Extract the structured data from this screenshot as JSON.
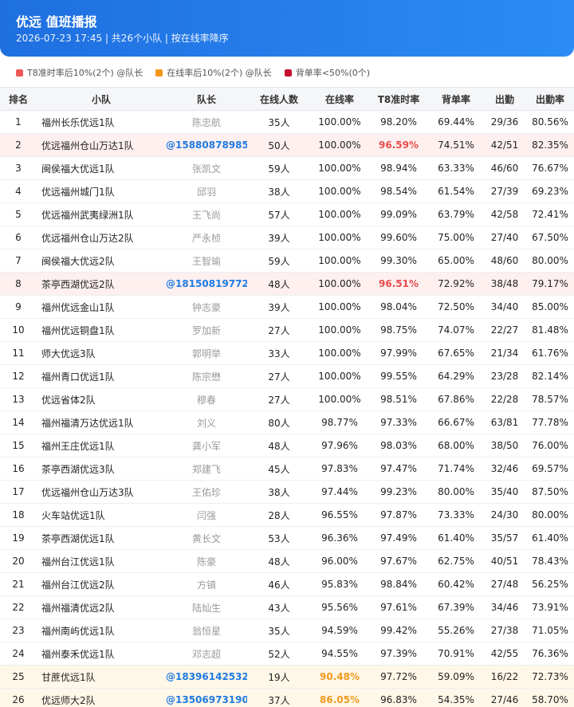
{
  "header": {
    "title": "优远 值班播报",
    "subtitle": "2026-07-23 17:45 | 共26个小队 | 按在线率降序"
  },
  "legend": [
    {
      "label": "T8准时率后10%(2个) @队长",
      "color": "#f0595a"
    },
    {
      "label": "在线率后10%(2个) @队长",
      "color": "#f3961c"
    },
    {
      "label": "背单率<50%(0个)",
      "color": "#c8102e"
    }
  ],
  "table": {
    "columns": [
      "排名",
      "小队",
      "队长",
      "在线人数",
      "在线率",
      "T8准时率",
      "背单率",
      "出勤",
      "出勤率"
    ],
    "rows": [
      {
        "rank": "1",
        "team": "福州长乐优远1队",
        "captain": "陈忠航",
        "online": "35人",
        "online_rate": "100.00%",
        "t8": "98.20%",
        "back": "69.44%",
        "attend": "29/36",
        "attend_rate": "80.56%"
      },
      {
        "rank": "2",
        "team": "优远福州仓山万达1队",
        "captain": "@15880878985",
        "online": "50人",
        "online_rate": "100.00%",
        "t8": "96.59%",
        "back": "74.51%",
        "attend": "42/51",
        "attend_rate": "82.35%",
        "flag": "t8"
      },
      {
        "rank": "3",
        "team": "闽侯福大优远1队",
        "captain": "张凯文",
        "online": "59人",
        "online_rate": "100.00%",
        "t8": "98.94%",
        "back": "63.33%",
        "attend": "46/60",
        "attend_rate": "76.67%"
      },
      {
        "rank": "4",
        "team": "优远福州城门1队",
        "captain": "邱羽",
        "online": "38人",
        "online_rate": "100.00%",
        "t8": "98.54%",
        "back": "61.54%",
        "attend": "27/39",
        "attend_rate": "69.23%"
      },
      {
        "rank": "5",
        "team": "优远福州武夷绿洲1队",
        "captain": "王飞尚",
        "online": "57人",
        "online_rate": "100.00%",
        "t8": "99.09%",
        "back": "63.79%",
        "attend": "42/58",
        "attend_rate": "72.41%"
      },
      {
        "rank": "6",
        "team": "优远福州仓山万达2队",
        "captain": "严永桢",
        "online": "39人",
        "online_rate": "100.00%",
        "t8": "99.60%",
        "back": "75.00%",
        "attend": "27/40",
        "attend_rate": "67.50%"
      },
      {
        "rank": "7",
        "team": "闽侯福大优远2队",
        "captain": "王智瑜",
        "online": "59人",
        "online_rate": "100.00%",
        "t8": "99.30%",
        "back": "65.00%",
        "attend": "48/60",
        "attend_rate": "80.00%"
      },
      {
        "rank": "8",
        "team": "茶亭西湖优远2队",
        "captain": "@18150819772",
        "online": "48人",
        "online_rate": "100.00%",
        "t8": "96.51%",
        "back": "72.92%",
        "attend": "38/48",
        "attend_rate": "79.17%",
        "flag": "t8"
      },
      {
        "rank": "9",
        "team": "福州优远金山1队",
        "captain": "钟志豪",
        "online": "39人",
        "online_rate": "100.00%",
        "t8": "98.04%",
        "back": "72.50%",
        "attend": "34/40",
        "attend_rate": "85.00%"
      },
      {
        "rank": "10",
        "team": "福州优远铜盘1队",
        "captain": "罗加新",
        "online": "27人",
        "online_rate": "100.00%",
        "t8": "98.75%",
        "back": "74.07%",
        "attend": "22/27",
        "attend_rate": "81.48%"
      },
      {
        "rank": "11",
        "team": "师大优远3队",
        "captain": "郭明举",
        "online": "33人",
        "online_rate": "100.00%",
        "t8": "97.99%",
        "back": "67.65%",
        "attend": "21/34",
        "attend_rate": "61.76%"
      },
      {
        "rank": "12",
        "team": "福州青口优远1队",
        "captain": "陈宗懋",
        "online": "27人",
        "online_rate": "100.00%",
        "t8": "99.55%",
        "back": "64.29%",
        "attend": "23/28",
        "attend_rate": "82.14%"
      },
      {
        "rank": "13",
        "team": "优远省体2队",
        "captain": "穆春",
        "online": "27人",
        "online_rate": "100.00%",
        "t8": "98.51%",
        "back": "67.86%",
        "attend": "22/28",
        "attend_rate": "78.57%"
      },
      {
        "rank": "14",
        "team": "福州福清万达优远1队",
        "captain": "刘义",
        "online": "80人",
        "online_rate": "98.77%",
        "t8": "97.33%",
        "back": "66.67%",
        "attend": "63/81",
        "attend_rate": "77.78%"
      },
      {
        "rank": "15",
        "team": "福州王庄优远1队",
        "captain": "龚小军",
        "online": "48人",
        "online_rate": "97.96%",
        "t8": "98.03%",
        "back": "68.00%",
        "attend": "38/50",
        "attend_rate": "76.00%"
      },
      {
        "rank": "16",
        "team": "茶亭西湖优远3队",
        "captain": "郑建飞",
        "online": "45人",
        "online_rate": "97.83%",
        "t8": "97.47%",
        "back": "71.74%",
        "attend": "32/46",
        "attend_rate": "69.57%"
      },
      {
        "rank": "17",
        "team": "优远福州仓山万达3队",
        "captain": "王佑珍",
        "online": "38人",
        "online_rate": "97.44%",
        "t8": "99.23%",
        "back": "80.00%",
        "attend": "35/40",
        "attend_rate": "87.50%"
      },
      {
        "rank": "18",
        "team": "火车站优远1队",
        "captain": "闫强",
        "online": "28人",
        "online_rate": "96.55%",
        "t8": "97.87%",
        "back": "73.33%",
        "attend": "24/30",
        "attend_rate": "80.00%"
      },
      {
        "rank": "19",
        "team": "茶亭西湖优远1队",
        "captain": "黄长文",
        "online": "53人",
        "online_rate": "96.36%",
        "t8": "97.49%",
        "back": "61.40%",
        "attend": "35/57",
        "attend_rate": "61.40%"
      },
      {
        "rank": "20",
        "team": "福州台江优远1队",
        "captain": "陈豪",
        "online": "48人",
        "online_rate": "96.00%",
        "t8": "97.67%",
        "back": "62.75%",
        "attend": "40/51",
        "attend_rate": "78.43%"
      },
      {
        "rank": "21",
        "team": "福州台江优远2队",
        "captain": "方镇",
        "online": "46人",
        "online_rate": "95.83%",
        "t8": "98.84%",
        "back": "60.42%",
        "attend": "27/48",
        "attend_rate": "56.25%"
      },
      {
        "rank": "22",
        "team": "福州福清优远2队",
        "captain": "陆灿生",
        "online": "43人",
        "online_rate": "95.56%",
        "t8": "97.61%",
        "back": "67.39%",
        "attend": "34/46",
        "attend_rate": "73.91%"
      },
      {
        "rank": "23",
        "team": "福州南屿优远1队",
        "captain": "翁恒星",
        "online": "35人",
        "online_rate": "94.59%",
        "t8": "99.42%",
        "back": "55.26%",
        "attend": "27/38",
        "attend_rate": "71.05%"
      },
      {
        "rank": "24",
        "team": "福州泰禾优远1队",
        "captain": "邓志超",
        "online": "52人",
        "online_rate": "94.55%",
        "t8": "97.39%",
        "back": "70.91%",
        "attend": "42/55",
        "attend_rate": "76.36%"
      },
      {
        "rank": "25",
        "team": "甘蔗优远1队",
        "captain": "@18396142532",
        "online": "19人",
        "online_rate": "90.48%",
        "t8": "97.72%",
        "back": "59.09%",
        "attend": "16/22",
        "attend_rate": "72.73%",
        "flag": "online"
      },
      {
        "rank": "26",
        "team": "优远师大2队",
        "captain": "@13506973190",
        "online": "37人",
        "online_rate": "86.05%",
        "t8": "96.83%",
        "back": "54.35%",
        "attend": "27/46",
        "attend_rate": "58.70%",
        "flag": "online"
      }
    ]
  }
}
